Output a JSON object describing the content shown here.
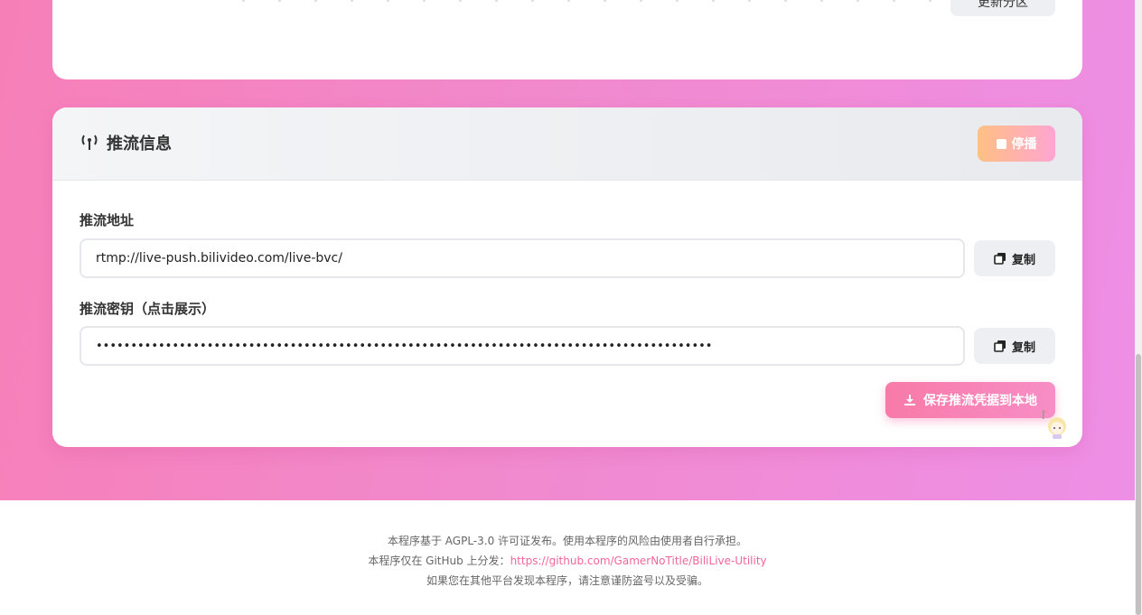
{
  "top_card": {
    "button_label": "更新分区"
  },
  "stream_card": {
    "title": "推流信息",
    "title_icon": "antenna-icon",
    "stop_button": "停播",
    "address_label": "推流地址",
    "address_value": "rtmp://live-push.bilivideo.com/live-bvc/",
    "key_label": "推流密钥（点击展示）",
    "key_value": "•••••••••••••••••••••••••••••••••••••••••••••••••••••••••••••••••••••••••••••••••••••••••",
    "copy_label": "复制",
    "save_button": "保存推流凭据到本地"
  },
  "footer": {
    "line1": "本程序基于 AGPL-3.0 许可证发布。使用本程序的风险由使用者自行承担。",
    "line2_prefix": "本程序仅在 GitHub 上分发：",
    "line2_link": "https://github.com/GamerNoTitle/BiliLive-Utility",
    "line3": "如果您在其他平台发现本程序，请注意谨防盗号以及受骗。"
  },
  "colors": {
    "accent": "#f2659b",
    "stop_gradient_start": "#ffc083",
    "stop_gradient_end": "#ffa5d2"
  }
}
